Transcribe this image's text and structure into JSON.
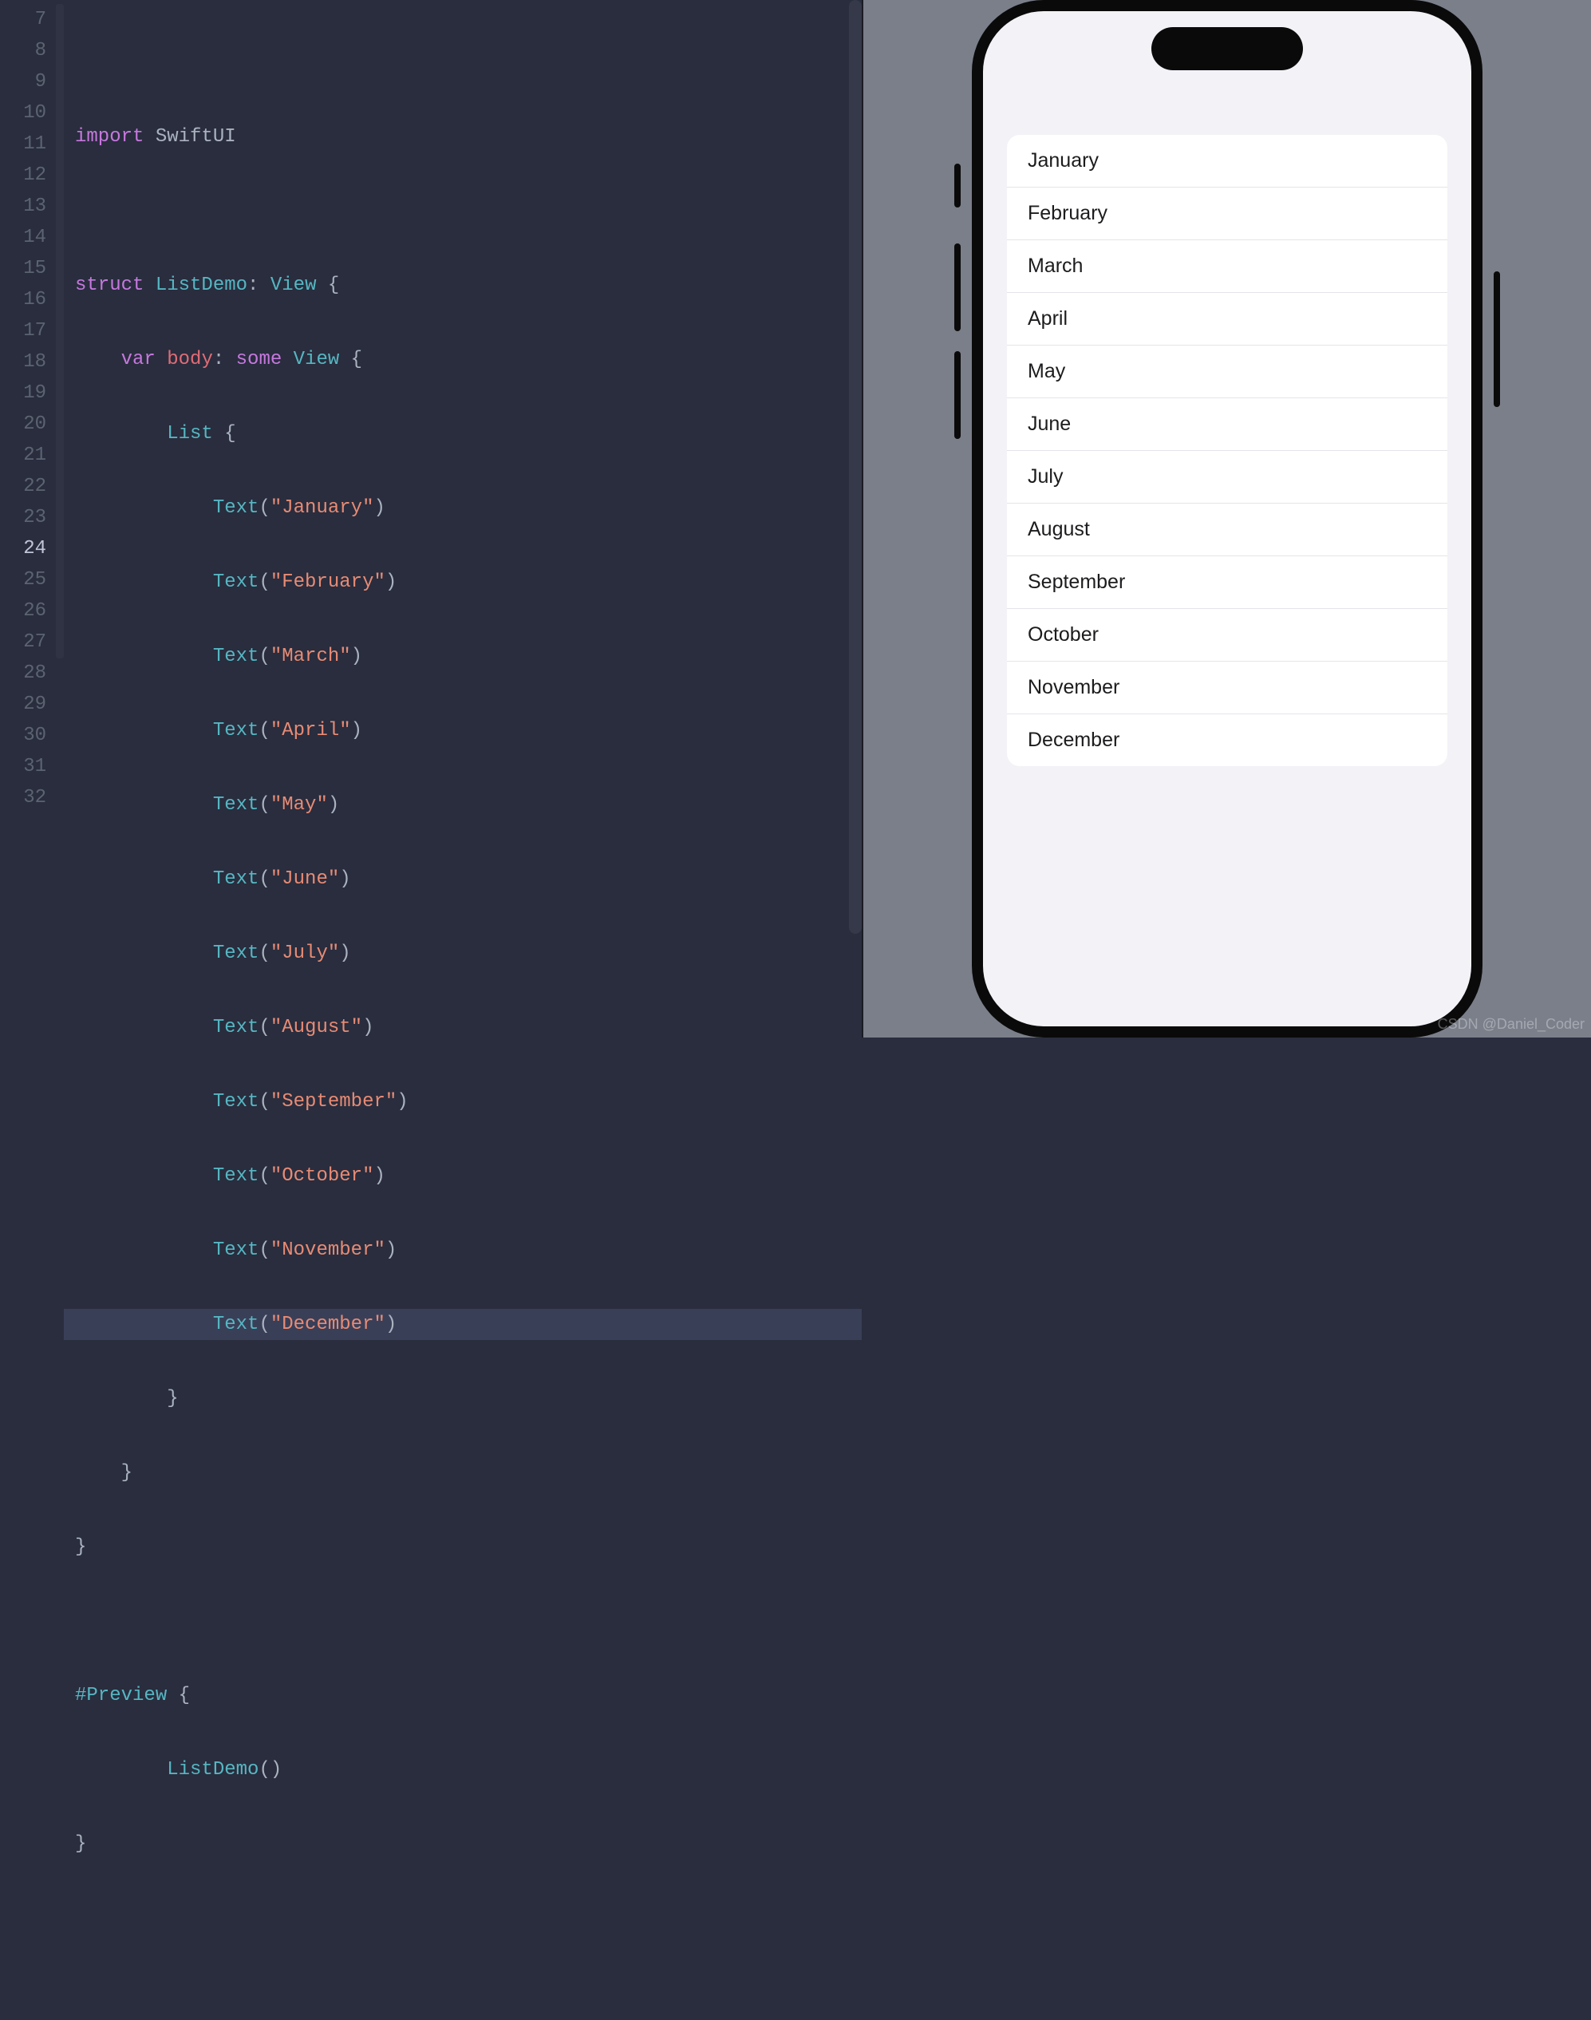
{
  "editor": {
    "gutter": [
      "7",
      "8",
      "9",
      "10",
      "11",
      "12",
      "13",
      "14",
      "15",
      "16",
      "17",
      "18",
      "19",
      "20",
      "21",
      "22",
      "23",
      "24",
      "25",
      "26",
      "27",
      "28",
      "29",
      "30",
      "31",
      "32"
    ],
    "highlighted_line": "24",
    "lines": {
      "l7": "",
      "l8_import": "import",
      "l8_mod": " SwiftUI",
      "l9": "",
      "l10_kw": "struct",
      "l10_name": " ListDemo",
      "l10_colon": ": ",
      "l10_proto": "View",
      "l10_brace": " {",
      "l11_var": "var",
      "l11_body": " body",
      "l11_colon": ": ",
      "l11_some": "some",
      "l11_view": " View",
      "l11_brace": " {",
      "l12_list": "List",
      "l12_brace": " {",
      "text_fn": "Text",
      "open_p": "(",
      "close_p": ")",
      "strings": {
        "jan": "\"January\"",
        "feb": "\"February\"",
        "mar": "\"March\"",
        "apr": "\"April\"",
        "may": "\"May\"",
        "jun": "\"June\"",
        "jul": "\"July\"",
        "aug": "\"August\"",
        "sep": "\"September\"",
        "oct": "\"October\"",
        "nov": "\"November\"",
        "dec": "\"December\""
      },
      "l25": "        }",
      "l26": "    }",
      "l27": "}",
      "l28": "",
      "l29_preview": "#Preview",
      "l29_brace": " {",
      "l30_call": "ListDemo",
      "l30_parens": "()",
      "l31": "}",
      "l32": ""
    }
  },
  "preview": {
    "list_items": [
      "January",
      "February",
      "March",
      "April",
      "May",
      "June",
      "July",
      "August",
      "September",
      "October",
      "November",
      "December"
    ]
  },
  "watermark": "CSDN @Daniel_Coder"
}
